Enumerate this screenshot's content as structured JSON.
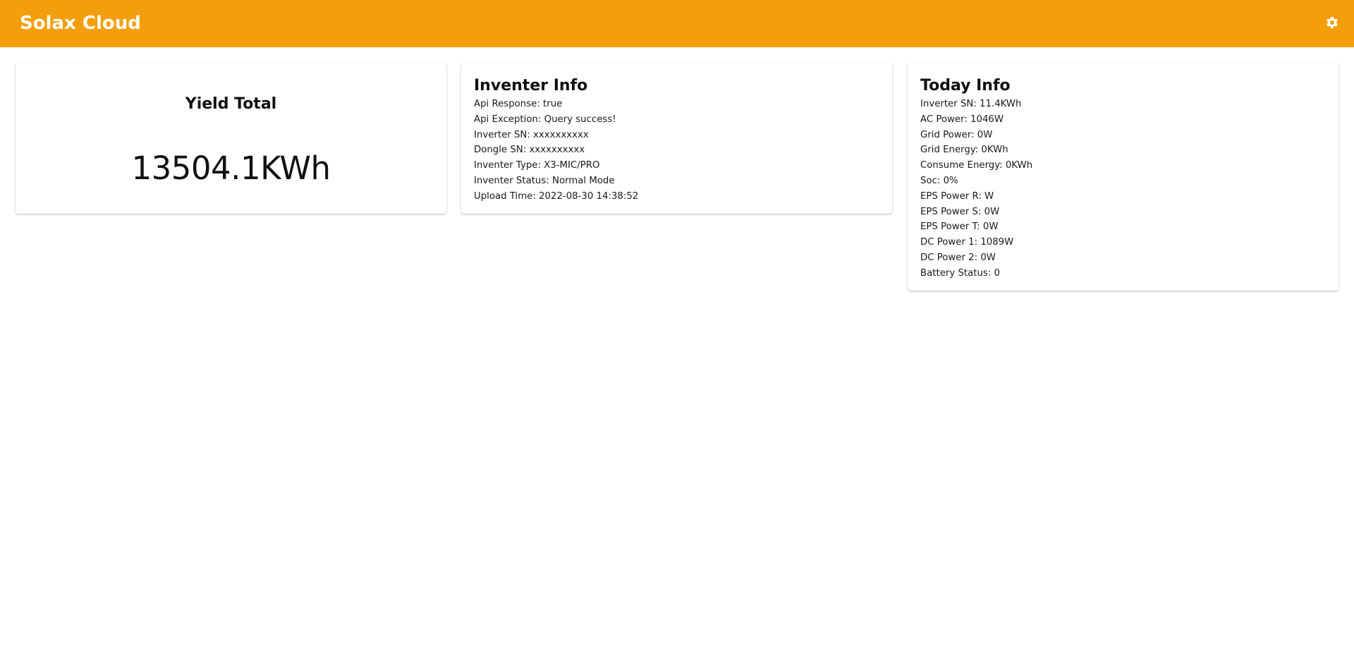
{
  "app_bar": {
    "title": "Solax Cloud",
    "settings_icon": "gear-icon",
    "background_color": "#f59e0b"
  },
  "yield_card": {
    "title": "Yield Total",
    "value": "13504.1KWh"
  },
  "inverter_card": {
    "title": "Inventer Info",
    "lines": [
      "Api Response: true",
      "Api Exception: Query success!",
      "Inverter SN: xxxxxxxxxx",
      "Dongle SN: xxxxxxxxxx",
      "Inventer Type: X3-MIC/PRO",
      "Inventer Status: Normal Mode",
      "Upload Time: 2022-08-30 14:38:52"
    ]
  },
  "today_card": {
    "title": "Today Info",
    "lines": [
      "Inverter SN: 11.4KWh",
      "AC Power: 1046W",
      "Grid Power: 0W",
      "Grid Energy: 0KWh",
      "Consume Energy: 0KWh",
      "Soc: 0%",
      "EPS Power R: W",
      "EPS Power S: 0W",
      "EPS Power T: 0W",
      "DC Power 1: 1089W",
      "DC Power 2: 0W",
      "Battery Status: 0"
    ]
  }
}
